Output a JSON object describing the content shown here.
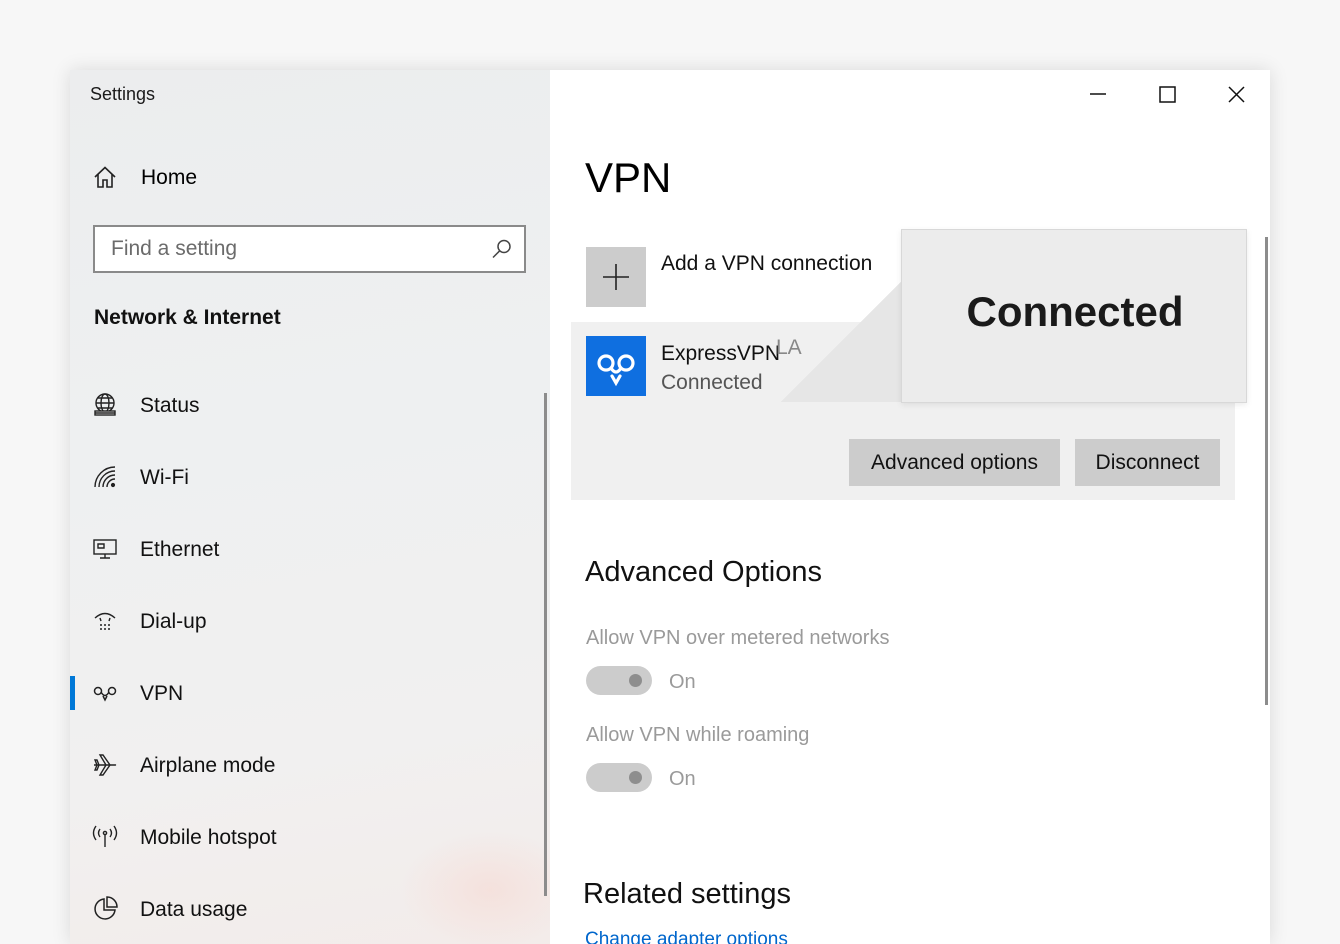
{
  "window": {
    "title": "Settings"
  },
  "left_nav": {
    "home_label": "Home",
    "search_placeholder": "Find a setting",
    "section_title": "Network & Internet",
    "items": [
      {
        "label": "Status",
        "icon": "globe-icon"
      },
      {
        "label": "Wi-Fi",
        "icon": "wifi-icon"
      },
      {
        "label": "Ethernet",
        "icon": "ethernet-icon"
      },
      {
        "label": "Dial-up",
        "icon": "dialup-icon"
      },
      {
        "label": "VPN",
        "icon": "vpn-icon",
        "active": true
      },
      {
        "label": "Airplane mode",
        "icon": "airplane-icon"
      },
      {
        "label": "Mobile hotspot",
        "icon": "hotspot-icon"
      },
      {
        "label": "Data usage",
        "icon": "pie-chart-icon"
      }
    ]
  },
  "main": {
    "title": "VPN",
    "add_connection_label": "Add a VPN connection",
    "connection": {
      "name": "ExpressVPN",
      "location": "LA",
      "status": "Connected",
      "advanced_button": "Advanced options",
      "disconnect_button": "Disconnect"
    },
    "tooltip": "Connected",
    "advanced": {
      "title": "Advanced Options",
      "options": [
        {
          "label": "Allow VPN over metered networks",
          "state": "On"
        },
        {
          "label": "Allow VPN while roaming",
          "state": "On"
        }
      ]
    },
    "related": {
      "title": "Related settings",
      "link": "Change adapter options"
    }
  },
  "colors": {
    "accent": "#0078d7",
    "vpn_logo": "#0f6fe0",
    "link": "#0066cc"
  }
}
